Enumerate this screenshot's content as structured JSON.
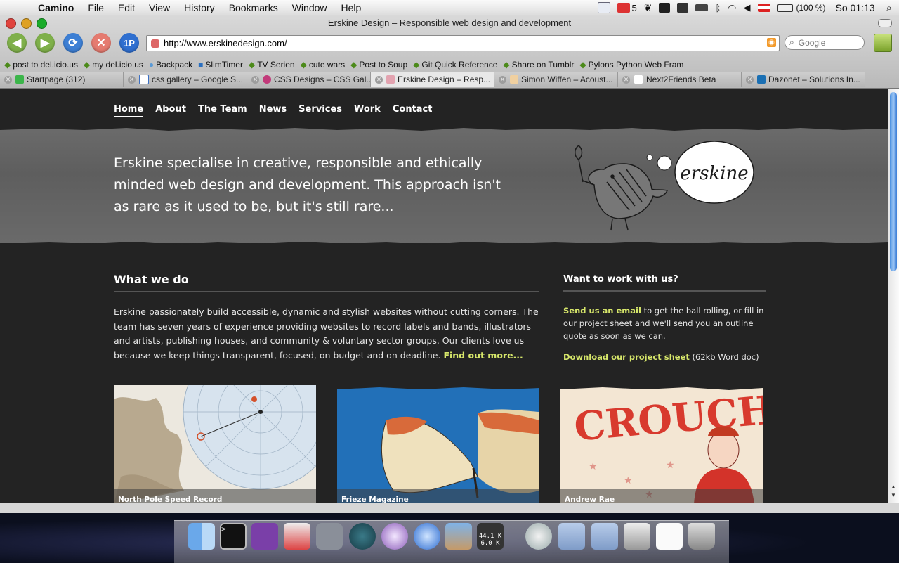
{
  "menubar": {
    "app_name": "Camino",
    "items": [
      "File",
      "Edit",
      "View",
      "History",
      "Bookmarks",
      "Window",
      "Help"
    ],
    "mail_count": "5",
    "battery": "(100 %)",
    "clock": "So 01:13"
  },
  "window": {
    "title": "Erskine Design – Responsible web design and development",
    "nav_buttons": [
      "back",
      "forward",
      "reload",
      "stop",
      "1P"
    ],
    "reload_icon": "reload-icon",
    "onepassword_label": "1P",
    "url": "http://www.erskinedesign.com/",
    "search_placeholder": "Google"
  },
  "bookmarks": [
    "post to del.icio.us",
    "my del.icio.us",
    "Backpack",
    "SlimTimer",
    "TV Serien",
    "cute wars",
    "Post to Soup",
    "Git Quick Reference",
    "Share on Tumblr",
    "Pylons Python Web Fram"
  ],
  "tabs": [
    {
      "label": "Startpage (312)",
      "active": false
    },
    {
      "label": "css gallery – Google S...",
      "active": false
    },
    {
      "label": "CSS Designs – CSS Gal...",
      "active": false
    },
    {
      "label": "Erskine Design – Resp...",
      "active": true
    },
    {
      "label": "Simon Wiffen – Acoust...",
      "active": false
    },
    {
      "label": "Next2Friends Beta",
      "active": false
    },
    {
      "label": "Dazonet – Solutions In...",
      "active": false
    }
  ],
  "site": {
    "nav": [
      "Home",
      "About",
      "The Team",
      "News",
      "Services",
      "Work",
      "Contact"
    ],
    "current_nav": "Home",
    "hero_text": "Erskine specialise in creative, responsible and ethically minded web design and development. This approach isn't as rare as it used to be, but it's still rare...",
    "logo_text": "erskine",
    "what_we_do": {
      "heading": "What we do",
      "body": "Erskine passionately build accessible, dynamic and stylish websites without cutting corners. The team has seven years of experience providing websites to record labels and bands, illustrators and artists, publishing houses, and community & voluntary sector groups. Our clients love us because we keep things transparent, focused, on budget and on deadline.",
      "more_link": "Find out more..."
    },
    "work_with_us": {
      "heading": "Want to work with us?",
      "email_link": "Send us an email",
      "email_text": " to get the ball rolling, or fill in our project sheet and we'll send you an outline quote as soon as we can.",
      "download_link": "Download our project sheet",
      "download_note": " (62kb Word doc)"
    },
    "portfolio": [
      {
        "caption": "North Pole Speed Record"
      },
      {
        "caption": "Frieze Magazine"
      },
      {
        "caption": "Andrew Rae",
        "poster_text": "CROUCH"
      }
    ]
  },
  "dock": {
    "items": [
      "Finder",
      "Terminal",
      "TextMate",
      "CSSEdit",
      "System Preferences",
      "Time Machine",
      "Adium",
      "Camino",
      "iPhoto",
      "Network Monitor",
      "Mail",
      "Documents",
      "Movies",
      "Disk",
      "Preview",
      "Trash"
    ],
    "net_up": "44.1 K",
    "net_down": "6.0 K"
  },
  "colors": {
    "page_bg": "#232323",
    "hero_bg": "#656565",
    "accent": "#d6e66a"
  }
}
